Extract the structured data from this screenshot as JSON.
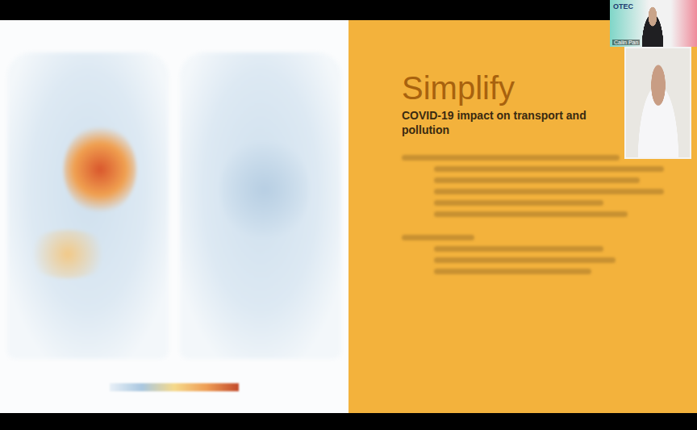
{
  "meeting": {
    "logo": "OTEC",
    "speaker_label": "Calin Pan"
  },
  "slide": {
    "title": "Simplify",
    "subtitle": "COVID-19 impact on transport and pollution"
  }
}
